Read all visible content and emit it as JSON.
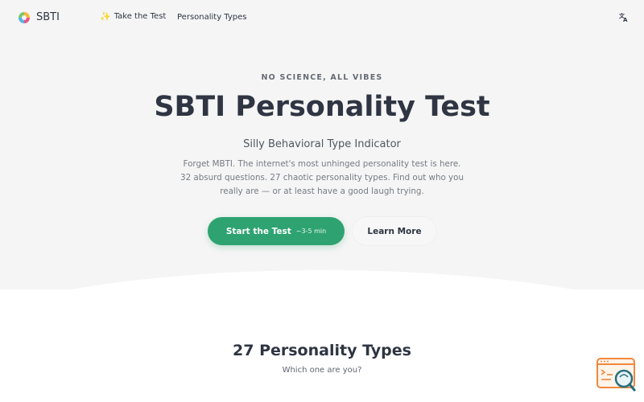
{
  "nav": {
    "brand": "SBTI",
    "take_test": "Take the Test",
    "personality_types": "Personality Types"
  },
  "hero": {
    "tagline": "NO SCIENCE, ALL VIBES",
    "title": "SBTI Personality Test",
    "subtitle": "Silly Behavioral Type Indicator",
    "description": "Forget MBTI. The internet's most unhinged personality test is here. 32 absurd questions. 27 chaotic personality types. Find out who you really are — or at least have a good laugh trying.",
    "start_label": "Start the Test",
    "start_duration": "~3-5 min",
    "learn_label": "Learn More"
  },
  "types_section": {
    "title": "27 Personality Types",
    "subtitle": "Which one are you?"
  },
  "colors": {
    "accent": "#2ea371",
    "text": "#2f3542",
    "hero_bg": "#f5f5f5",
    "widget": "#f0883e"
  },
  "icons": {
    "logo": "rainbow-circle-logo",
    "take_test": "sparkles-icon",
    "language": "translate-icon",
    "widget": "search-chat-widget-icon"
  }
}
